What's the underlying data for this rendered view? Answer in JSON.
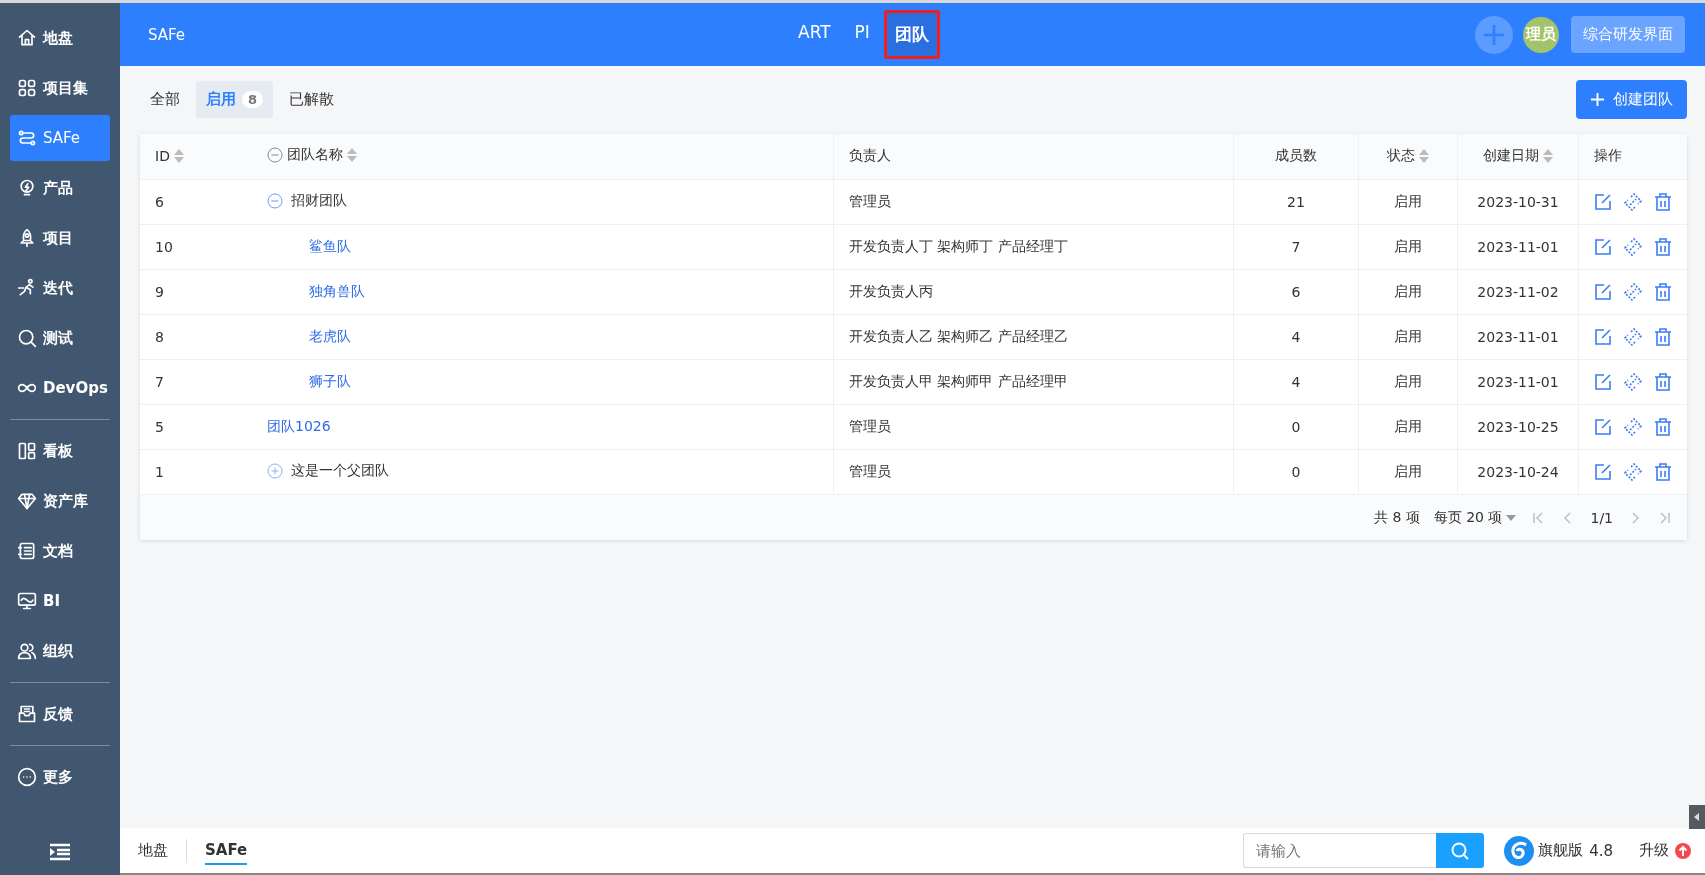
{
  "sidebar": {
    "groups": [
      {
        "items": [
          {
            "label": "地盘",
            "selected": false
          },
          {
            "label": "项目集",
            "selected": false
          },
          {
            "label": "SAFe",
            "selected": true
          },
          {
            "label": "产品",
            "selected": false
          },
          {
            "label": "项目",
            "selected": false
          },
          {
            "label": "迭代",
            "selected": false
          },
          {
            "label": "测试",
            "selected": false
          },
          {
            "label": "DevOps",
            "selected": false
          }
        ]
      },
      {
        "items": [
          {
            "label": "看板",
            "selected": false
          },
          {
            "label": "资产库",
            "selected": false
          },
          {
            "label": "文档",
            "selected": false
          },
          {
            "label": "BI",
            "selected": false
          },
          {
            "label": "组织",
            "selected": false
          }
        ]
      },
      {
        "items": [
          {
            "label": "反馈",
            "selected": false
          }
        ]
      },
      {
        "items": [
          {
            "label": "更多",
            "selected": false
          }
        ]
      }
    ]
  },
  "header": {
    "title": "SAFe",
    "nav": [
      {
        "label": "ART",
        "selected": false
      },
      {
        "label": "PI",
        "selected": false
      },
      {
        "label": "团队",
        "selected": true
      }
    ],
    "avatar": "理员",
    "switch_button": "综合研发界面"
  },
  "filter_tabs": [
    {
      "label": "全部",
      "selected": false
    },
    {
      "label": "启用",
      "count": "8",
      "selected": true
    },
    {
      "label": "已解散",
      "selected": false
    }
  ],
  "create_button": "创建团队",
  "table": {
    "columns": [
      {
        "label": "ID",
        "sortable": true
      },
      {
        "label": "团队名称",
        "sortable": true
      },
      {
        "label": "负责人",
        "sortable": false
      },
      {
        "label": "成员数",
        "sortable": false
      },
      {
        "label": "状态",
        "sortable": true
      },
      {
        "label": "创建日期",
        "sortable": true
      },
      {
        "label": "操作",
        "sortable": false
      }
    ],
    "rows": [
      {
        "id": "6",
        "name": "招财团队",
        "kind": "group",
        "expanded": true,
        "owner": "管理员",
        "members": "21",
        "status": "启用",
        "created": "2023-10-31",
        "children": [
          {
            "id": "10",
            "name": "鲨鱼队",
            "kind": "team",
            "owner": "开发负责人丁 架构师丁 产品经理丁",
            "members": "7",
            "status": "启用",
            "created": "2023-11-01"
          },
          {
            "id": "9",
            "name": "独角兽队",
            "kind": "team",
            "owner": "开发负责人丙",
            "members": "6",
            "status": "启用",
            "created": "2023-11-02"
          },
          {
            "id": "8",
            "name": "老虎队",
            "kind": "team",
            "owner": "开发负责人乙 架构师乙 产品经理乙",
            "members": "4",
            "status": "启用",
            "created": "2023-11-01"
          },
          {
            "id": "7",
            "name": "狮子队",
            "kind": "team",
            "owner": "开发负责人甲 架构师甲 产品经理甲",
            "members": "4",
            "status": "启用",
            "created": "2023-11-01"
          }
        ]
      },
      {
        "id": "5",
        "name": "团队1026",
        "kind": "team",
        "owner": "管理员",
        "members": "0",
        "status": "启用",
        "created": "2023-10-25"
      },
      {
        "id": "1",
        "name": "这是一个父团队",
        "kind": "group",
        "expanded": false,
        "owner": "管理员",
        "members": "0",
        "status": "启用",
        "created": "2023-10-24"
      }
    ]
  },
  "pagination": {
    "total": "共 8 项",
    "page_size": "每页 20 项",
    "page": "1/1"
  },
  "bottom_bar": {
    "tabs": [
      {
        "label": "地盘",
        "selected": false
      },
      {
        "label": "SAFe",
        "selected": true
      }
    ],
    "search_placeholder": "请输入",
    "edition": "旗舰版",
    "version": "4.8",
    "upgrade": "升级"
  }
}
